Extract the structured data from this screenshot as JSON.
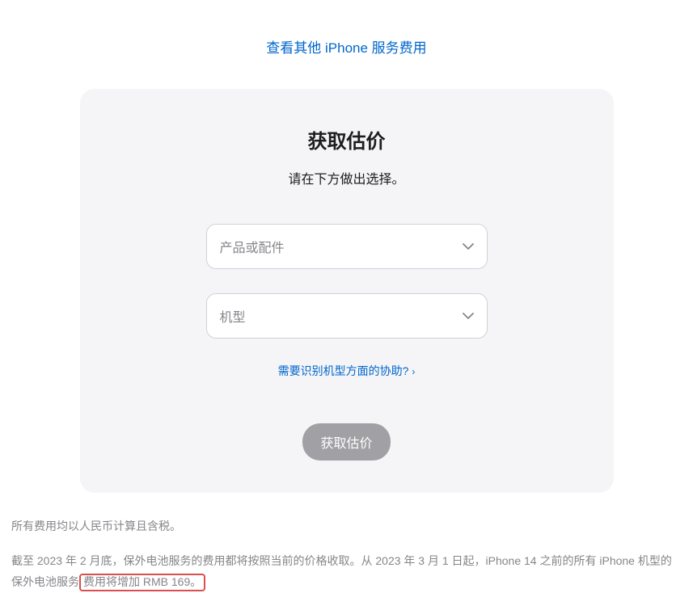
{
  "topLink": "查看其他 iPhone 服务费用",
  "card": {
    "title": "获取估价",
    "subtitle": "请在下方做出选择。",
    "select1": "产品或配件",
    "select2": "机型",
    "helpLink": "需要识别机型方面的协助?",
    "submit": "获取估价"
  },
  "notes": {
    "line1": "所有费用均以人民币计算且含税。",
    "line2_pre": "截至 2023 年 2 月底，保外电池服务的费用都将按照当前的价格收取。从 2023 年 3 月 1 日起，iPhone 14 之前的所有 iPhone 机型的保外电池服务",
    "line2_highlight": "费用将增加 RMB 169。"
  }
}
